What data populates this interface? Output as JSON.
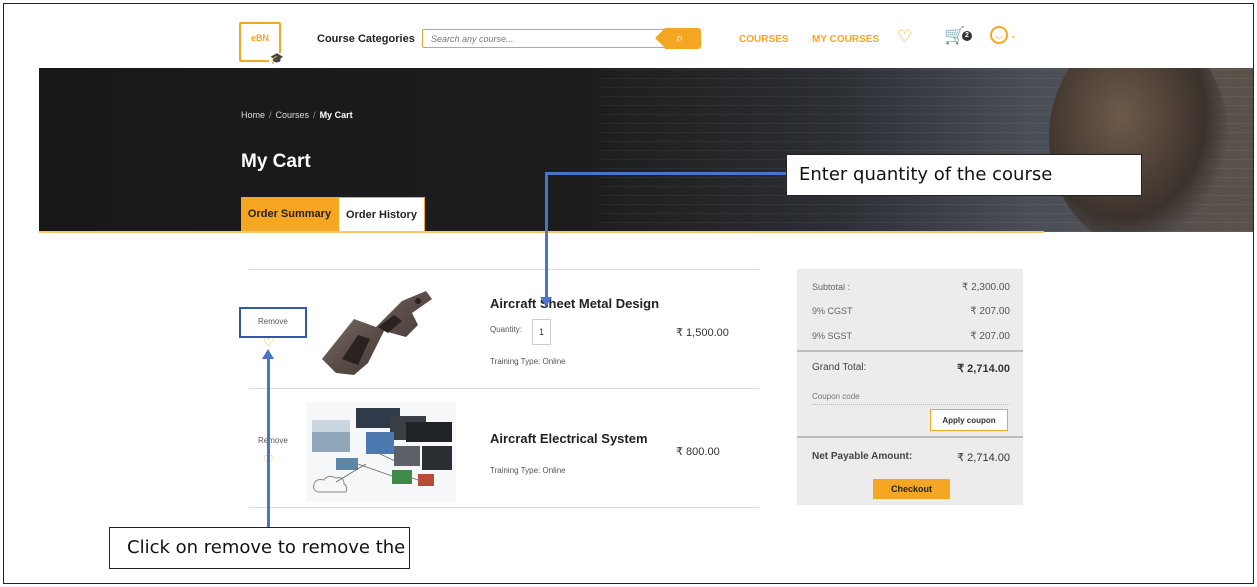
{
  "nav": {
    "logo": "eBN",
    "course_categories": "Course Categories",
    "search_placeholder": "Search any course...",
    "courses": "COURSES",
    "my_courses": "MY COURSES",
    "cart_count": "2"
  },
  "hero": {
    "breadcrumb": [
      "Home",
      "Courses",
      "My Cart"
    ],
    "title": "My Cart",
    "tabs": [
      "Order Summary",
      "Order History"
    ],
    "active_tab": "Order Summary"
  },
  "cart": {
    "items": [
      {
        "remove_label": "Remove",
        "title": "Aircraft Sheet Metal Design",
        "quantity_label": "Quantity:",
        "quantity": "1",
        "training_type": "Training Type: Online",
        "price": "₹ 1,500.00"
      },
      {
        "remove_label": "Remove",
        "title": "Aircraft Electrical System",
        "training_type": "Training Type: Online",
        "price": "₹ 800.00"
      }
    ]
  },
  "summary": {
    "subtotal_label": "Subtotal :",
    "subtotal": "₹ 2,300.00",
    "cgst_label": "9% CGST",
    "cgst": "₹ 207.00",
    "sgst_label": "9% SGST",
    "sgst": "₹ 207.00",
    "grand_total_label": "Grand Total:",
    "grand_total": "₹ 2,714.00",
    "coupon_placeholder": "Coupon code",
    "apply_coupon": "Apply coupon",
    "net_payable_label": "Net Payable Amount:",
    "net_payable": "₹ 2,714.00",
    "checkout": "Checkout"
  },
  "annotations": {
    "quantity_callout": "Enter quantity of the course",
    "remove_callout": "Click on remove to remove the courses",
    "line_color": "#4a74c7"
  },
  "colors": {
    "accent": "#f5a623",
    "hero_bg": "#1d1d1d"
  }
}
